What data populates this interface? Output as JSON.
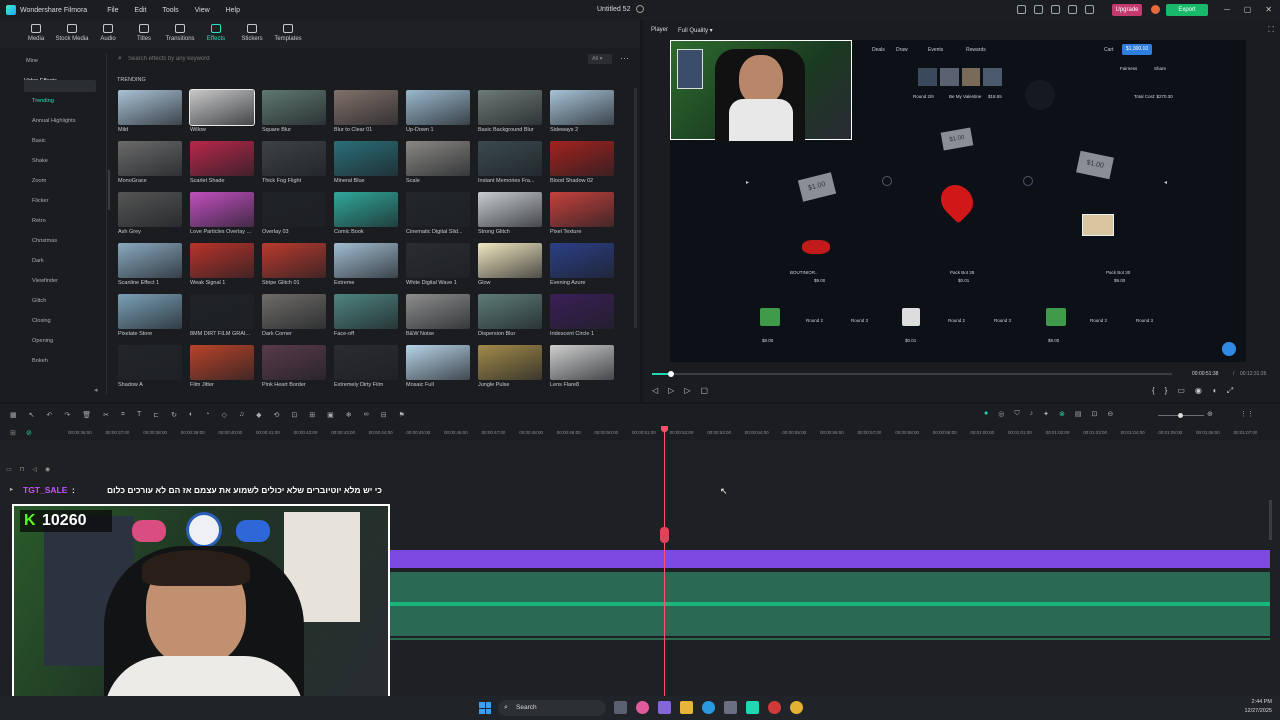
{
  "app": {
    "name": "Wondershare Filmora",
    "project": "Untitled 52",
    "menu": [
      "File",
      "Edit",
      "Tools",
      "View",
      "Help"
    ],
    "upgrade": "Upgrade",
    "export": "Export"
  },
  "tabs": [
    "Media",
    "Stock Media",
    "Audio",
    "Titles",
    "Transitions",
    "Effects",
    "Stickers",
    "Templates"
  ],
  "sidebar": {
    "items": [
      "Mine",
      "Video Effects",
      "Trending",
      "Annual Highlights",
      "Basic",
      "Shake",
      "Zoom",
      "Flicker",
      "Retro",
      "Christmas",
      "Dark",
      "Viewfinder",
      "Glitch",
      "Closing",
      "Opening",
      "Bokeh"
    ]
  },
  "search": {
    "placeholder": "Search effects by any keyword",
    "filter": "All"
  },
  "section": "TRENDING",
  "effects": [
    {
      "name": "Mild",
      "color": "#a9c2d6"
    },
    {
      "name": "Willow",
      "color": "#c8c8c8"
    },
    {
      "name": "Square Blur",
      "color": "#5f7870"
    },
    {
      "name": "Blur to Clear 01",
      "color": "#82706a"
    },
    {
      "name": "Up-Down 1",
      "color": "#9ab8cc"
    },
    {
      "name": "Basic Background Blur",
      "color": "#6d7a76"
    },
    {
      "name": "Sideways 2",
      "color": "#a6c2d6"
    },
    {
      "name": "MonoGrace",
      "color": "#6a6a6a"
    },
    {
      "name": "Scarlet Shade",
      "color": "#b8274a"
    },
    {
      "name": "Thick Fog Flight",
      "color": "#3d4246"
    },
    {
      "name": "Mineral Blue",
      "color": "#2b6f79"
    },
    {
      "name": "Scale",
      "color": "#8a8884"
    },
    {
      "name": "Instant Memories Fra...",
      "color": "#3a4a50"
    },
    {
      "name": "Blood Shadow 02",
      "color": "#a3221f"
    },
    {
      "name": "Ash Grey",
      "color": "#555555"
    },
    {
      "name": "Love Particles Overlay ...",
      "color": "#c24fc0"
    },
    {
      "name": "Overlay 03",
      "color": "#1f2226"
    },
    {
      "name": "Comic Book",
      "color": "#30a89a"
    },
    {
      "name": "Cinematic Digital Slid...",
      "color": "#22272c"
    },
    {
      "name": "Strong Glitch",
      "color": "#c7ccd0"
    },
    {
      "name": "Pixel Texture",
      "color": "#c4413c"
    },
    {
      "name": "Scanline Effect 1",
      "color": "#89a9bf"
    },
    {
      "name": "Weak Signal 1",
      "color": "#b9332b"
    },
    {
      "name": "Stripe Glitch 01",
      "color": "#ba3a2e"
    },
    {
      "name": "Extreme",
      "color": "#a1bdd1"
    },
    {
      "name": "White Digital Wave 1",
      "color": "#2a2d30"
    },
    {
      "name": "Glow",
      "color": "#f0e6bf"
    },
    {
      "name": "Evening Azure",
      "color": "#2b3f87"
    },
    {
      "name": "Pixelate Store",
      "color": "#7aa0b6"
    },
    {
      "name": "8MM DIRT FILM GRAI...",
      "color": "#202326"
    },
    {
      "name": "Dark Corner",
      "color": "#6f6c68"
    },
    {
      "name": "Face-off",
      "color": "#4e8480"
    },
    {
      "name": "B&W Noise",
      "color": "#8d8d8d"
    },
    {
      "name": "Dispersion Blur",
      "color": "#5d7d78"
    },
    {
      "name": "Iridescent Circle 1",
      "color": "#3b1f58"
    },
    {
      "name": "Shadow A",
      "color": "#22252a"
    },
    {
      "name": "Film Jitter",
      "color": "#b9432a"
    },
    {
      "name": "Pink Heart Border",
      "color": "#5a3a4a"
    },
    {
      "name": "Extremely Dirty Film",
      "color": "#2a2c2f"
    },
    {
      "name": "Mosaic Full",
      "color": "#b7d4e8"
    },
    {
      "name": "Jungle Pulse",
      "color": "#a38a4a"
    },
    {
      "name": "Lens Flare8",
      "color": "#cfcfcf"
    }
  ],
  "player": {
    "label": "Player",
    "quality": "Full Quality",
    "time_current": "00:00:51:38",
    "time_total": "00:12:31:26",
    "progress": 0.06
  },
  "preview": {
    "nav": [
      "Deals",
      "Draw",
      "Events",
      "Rewards"
    ],
    "cart": "Cart",
    "balance": "$1,300.10",
    "round": "Round 2/9",
    "valentine": "Be My Valentine",
    "val_price": "$18.55",
    "total": "Total Cost: $270.30",
    "fairness": "Fairness",
    "share": "Share",
    "money": [
      "$1.00",
      "$1.00",
      "$1.00"
    ],
    "packs": [
      {
        "name": "BOUTINIOR..",
        "price": "$9.00"
      },
      {
        "name": "Pack Bot 28",
        "price": "$0.01"
      },
      {
        "name": "Pack Bot 30",
        "price": "$9.00"
      }
    ],
    "rounds": [
      "Round 2",
      "Round 3",
      "Round 2",
      "Round 3",
      "Round 2",
      "Round 3"
    ],
    "slot_prices": [
      "$8.00",
      "$0.01",
      "$9.00"
    ]
  },
  "ruler": [
    "00:00:36:00",
    "00:00:37:00",
    "00:00:38:00",
    "00:00:39:00",
    "00:00:40:00",
    "00:00:41:00",
    "00:00:42:00",
    "00:00:43:00",
    "00:00:44:00",
    "00:00:45:00",
    "00:00:46:00",
    "00:00:47:00",
    "00:00:48:00",
    "00:00:49:00",
    "00:00:50:00",
    "00:00:51:00",
    "00:00:52:00",
    "00:00:53:00",
    "00:00:54:00",
    "00:00:55:00",
    "00:00:56:00",
    "00:00:57:00",
    "00:00:58:00",
    "00:00:59:00",
    "00:01:00:00",
    "00:01:01:00",
    "00:01:02:00",
    "00:01:03:00",
    "00:01:04:00",
    "00:01:05:00",
    "00:01:06:00",
    "00:01:07:00"
  ],
  "chat": {
    "user": "TGT_SALE",
    "message": "כי יש מלא יוטיוברים שלא יכולים לשמוע את עצמם אז הם לא עורכים כלום"
  },
  "stream": {
    "count": "10260",
    "badge": "K"
  },
  "taskbar": {
    "search": "Search",
    "time": "2:44 PM",
    "date": "12/27/2025"
  }
}
